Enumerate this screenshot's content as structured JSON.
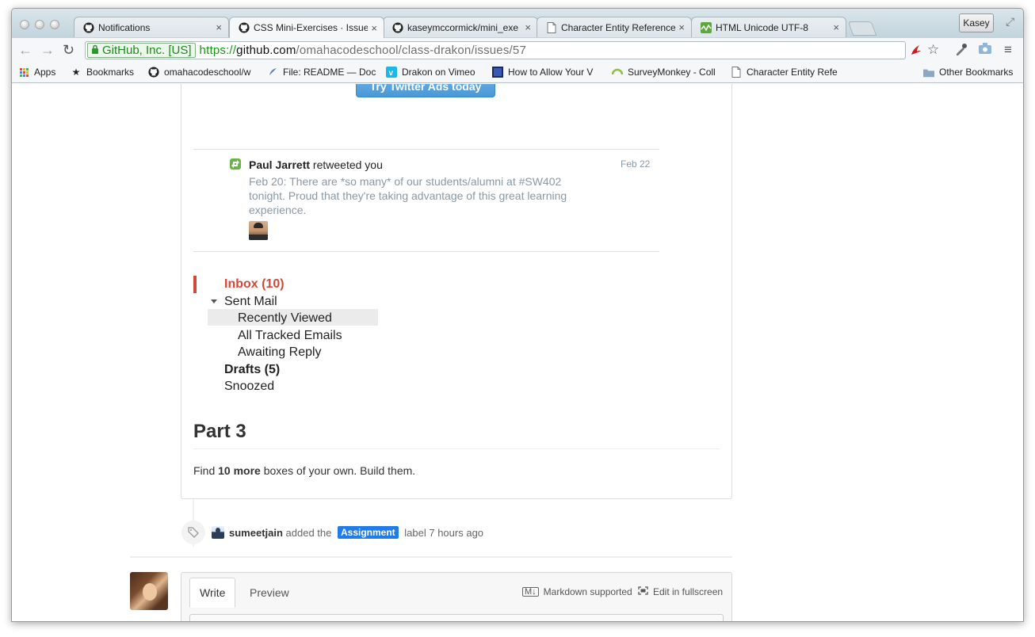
{
  "browser": {
    "tabs": [
      {
        "title": "Notifications",
        "favicon": "github-icon",
        "active": false
      },
      {
        "title": "CSS Mini-Exercises · Issue",
        "favicon": "github-icon",
        "active": true
      },
      {
        "title": "kaseymccormick/mini_exe",
        "favicon": "github-icon",
        "active": false
      },
      {
        "title": "Character Entity Reference",
        "favicon": "page-icon",
        "active": false
      },
      {
        "title": "HTML Unicode UTF-8",
        "favicon": "green-wave-icon",
        "active": false
      }
    ],
    "tab_close_glyph": "×",
    "profile_name": "Kasey",
    "ev_badge": "GitHub, Inc. [US]",
    "url_scheme": "https://",
    "url_host": "github.com",
    "url_path": "/omahacodeschool/class-drakon/issues/57",
    "bookmarks": [
      {
        "label": "Apps",
        "icon": "apps-grid-icon"
      },
      {
        "label": "Bookmarks",
        "icon": "star-icon"
      },
      {
        "label": "omahacodeschool/w",
        "icon": "github-icon"
      },
      {
        "label": "File: README — Doc",
        "icon": "feather-icon"
      },
      {
        "label": "Drakon on Vimeo",
        "icon": "vimeo-icon"
      },
      {
        "label": "How to Allow Your V",
        "icon": "photo-icon"
      },
      {
        "label": "SurveyMonkey - Coll",
        "icon": "surveymonkey-icon"
      },
      {
        "label": "Character Entity Refe",
        "icon": "page-icon"
      }
    ],
    "other_bookmarks": "Other Bookmarks"
  },
  "content": {
    "twitter_button": "Try Twitter Ads today",
    "notification": {
      "user": "Paul Jarrett",
      "action": " retweeted you",
      "date": "Feb 22",
      "text": "Feb 20: There are *so many* of our students/alumni at #SW402 tonight. Proud that they're taking advantage of this great learning experience."
    },
    "mail": {
      "inbox": "Inbox (10)",
      "sent": "Sent Mail",
      "recently_viewed": "Recently Viewed",
      "all_tracked": "All Tracked Emails",
      "awaiting": "Awaiting Reply",
      "drafts": "Drafts (5)",
      "snoozed": "Snoozed"
    },
    "heading": "Part 3",
    "para_pre": "Find ",
    "para_bold": "10 more",
    "para_post": " boxes of your own. Build them.",
    "event": {
      "user": "sumeetjain",
      "pre": " added the ",
      "label": "Assignment",
      "post": " label 7 hours ago",
      "label_color": "#1f7ce8"
    },
    "comment": {
      "tab_write": "Write",
      "tab_preview": "Preview",
      "markdown": "Markdown supported",
      "fullscreen": "Edit in fullscreen"
    }
  },
  "colors": {
    "inbox_red": "#d14836",
    "twitter_blue": "#55acee",
    "retweet_green": "#6bb34a",
    "tweet_gray": "#8899a6"
  }
}
